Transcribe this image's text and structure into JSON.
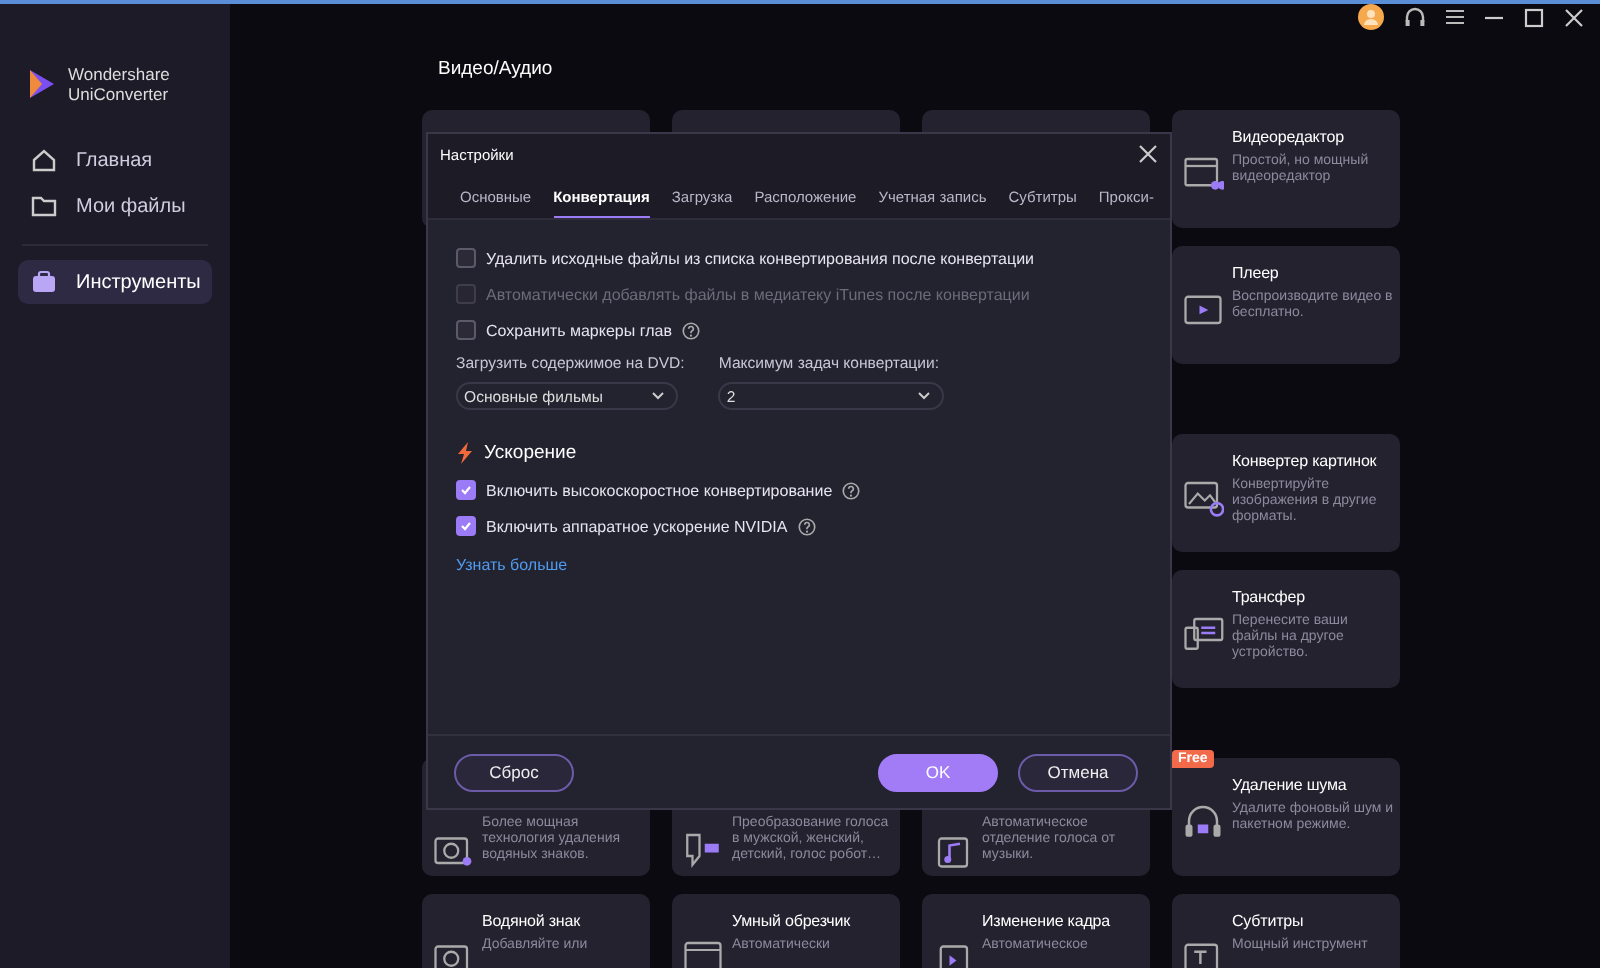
{
  "app": {
    "name": [
      "Wondershare",
      "UniConverter"
    ]
  },
  "nav": [
    {
      "label": "Главная",
      "selected": false
    },
    {
      "label": "Мои файлы",
      "selected": false
    },
    {
      "label": "Инструменты",
      "selected": true
    }
  ],
  "sections": [
    {
      "title": "Видео/Аудио",
      "rows": [
        [
          {
            "kind": "covered"
          },
          {
            "kind": "covered"
          },
          {
            "kind": "covered"
          },
          {
            "kind": "tool",
            "title": "Видеоредактор",
            "description": "Простой, но мощный видеоредактор"
          }
        ],
        [
          {
            "kind": "tool",
            "title": "Плеер",
            "description": "Воспроизводите видео в бесплатно."
          }
        ]
      ]
    },
    {
      "rows": [
        [
          {
            "kind": "tool",
            "title": "Конвертер картинок",
            "description": "Конвертируйте изображения в другие форматы."
          }
        ],
        [
          {
            "kind": "tool",
            "title": "Трансфер",
            "description": "Перенесите ваши файлы на другое устройство."
          }
        ]
      ]
    },
    {
      "rows": [
        [
          {
            "kind": "partial",
            "description": "Более мощная технология удаления водяных знаков."
          },
          {
            "kind": "partial",
            "description": "Преобразование голоса в мужской, женский, детский, голос робот…"
          },
          {
            "kind": "partial",
            "description": "Автоматическое отделение голоса от музыки."
          },
          {
            "kind": "tool",
            "title": "Удаление шума",
            "description": "Удалите фоновый шум и пакетном режиме.",
            "badge": "Free"
          }
        ],
        [
          {
            "kind": "tool",
            "title": "Водяной знак",
            "description": "Добавляйте или"
          },
          {
            "kind": "tool",
            "title": "Умный обрезчик",
            "description": "Автоматически"
          },
          {
            "kind": "tool",
            "title": "Изменение кадра",
            "description": "Автоматическое"
          },
          {
            "kind": "tool",
            "title": "Субтитры",
            "description": "Мощный инструмент"
          }
        ]
      ]
    }
  ],
  "dialog": {
    "title": "Настройки",
    "tabs": [
      {
        "label": "Основные",
        "selected": false
      },
      {
        "label": "Конвертация",
        "selected": true
      },
      {
        "label": "Загрузка",
        "selected": false
      },
      {
        "label": "Расположение",
        "selected": false
      },
      {
        "label": "Учетная запись",
        "selected": false
      },
      {
        "label": "Субтитры",
        "selected": false
      },
      {
        "label": "Прокси-",
        "selected": false
      }
    ],
    "options": [
      {
        "label": "Удалить исходные файлы из списка конвертирования после конвертации",
        "checked": false,
        "disabled": false,
        "help": false
      },
      {
        "label": "Автоматически добавлять файлы в медиатеку iTunes после конвертации",
        "checked": false,
        "disabled": true,
        "help": false
      },
      {
        "label": "Сохранить маркеры глав",
        "checked": false,
        "disabled": false,
        "help": true
      }
    ],
    "selects": [
      {
        "label": "Загрузить содержимое на DVD:",
        "value": "Основные фильмы"
      },
      {
        "label": "Максимум задач конвертации:",
        "value": "2"
      }
    ],
    "acceleration": {
      "title": "Ускорение",
      "options": [
        {
          "label": "Включить высокоскоростное конвертирование",
          "checked": true,
          "disabled": false,
          "help": true
        },
        {
          "label": "Включить аппаратное ускорение NVIDIA",
          "checked": true,
          "disabled": false,
          "help": true
        }
      ],
      "link": "Узнать больше"
    },
    "buttons": [
      {
        "label": "Сброс",
        "kind": "secondary"
      },
      {
        "label": "OK",
        "kind": "primary"
      },
      {
        "label": "Отмена",
        "kind": "secondary"
      }
    ]
  }
}
